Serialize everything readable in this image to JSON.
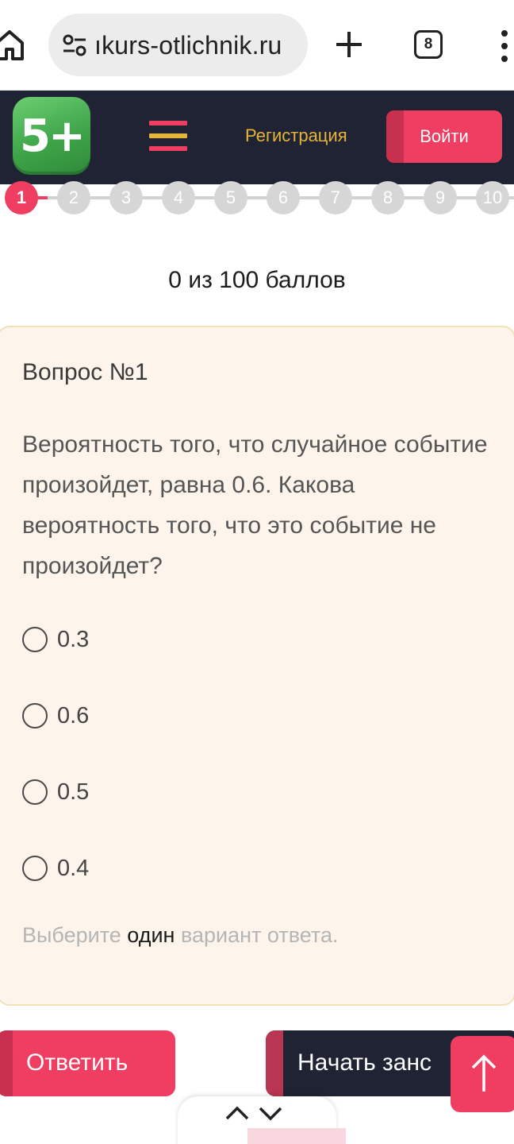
{
  "browser": {
    "url": "ıkurs-otlichnik.ru",
    "tab_count": "8"
  },
  "header": {
    "logo_text": "5+",
    "register_label": "Регистрация",
    "login_label": "Войти",
    "colors": {
      "bg": "#1f2333",
      "accent": "#ef3e62",
      "link": "#e6b43a",
      "logo_green": "#3fa549"
    }
  },
  "steps": {
    "items": [
      "1",
      "2",
      "3",
      "4",
      "5",
      "6",
      "7",
      "8",
      "9",
      "10"
    ],
    "active_index": 0
  },
  "score": "0 из 100 баллов",
  "question": {
    "title": "Вопрос №1",
    "text": "Вероятность того, что случайное событие произойдет, равна 0.6. Какова вероятность того, что это событие не произойдет?",
    "options": [
      "0.3",
      "0.6",
      "0.5",
      "0.4"
    ],
    "hint_before": "Выберите",
    "hint_strong": "один",
    "hint_after": "вариант ответа."
  },
  "actions": {
    "answer_label": "Ответить",
    "start_label": "Начать занс"
  },
  "icons": {
    "home": "home-icon",
    "site_settings": "tune-icon",
    "new_tab": "plus-icon",
    "tabs": "tabs-icon",
    "menu": "more-vert-icon",
    "scroll_top": "arrow-up-icon",
    "find_prev": "chevron-up-icon",
    "find_next": "chevron-down-icon"
  }
}
